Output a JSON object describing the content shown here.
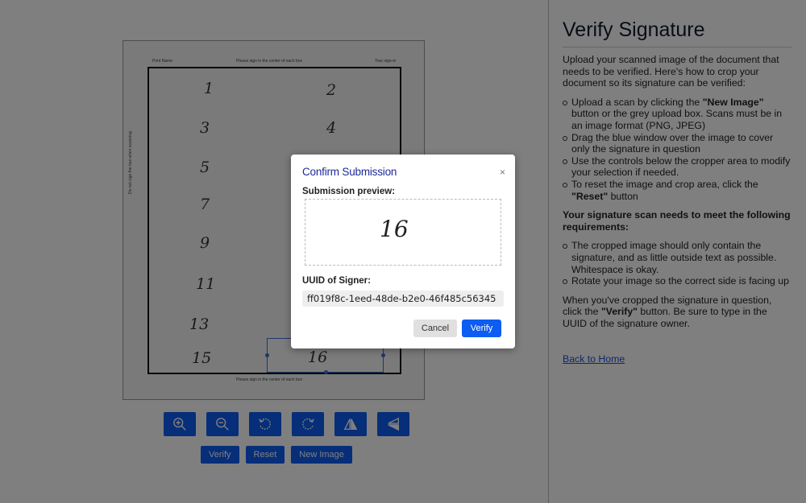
{
  "document": {
    "header_left": "Print Name",
    "header_center": "Please sign in the center of each box",
    "header_right": "Your sign-in",
    "side_text": "Do not sign the box when scanning",
    "footer_text": "Please sign in the center of each box",
    "numbers": [
      "1",
      "2",
      "3",
      "4",
      "5",
      "7",
      "9",
      "11",
      "13",
      "15"
    ],
    "crop_number": "16"
  },
  "toolbar": {
    "icons": [
      "zoom-in-icon",
      "zoom-out-icon",
      "rotate-left-icon",
      "rotate-right-icon",
      "flip-horizontal-icon",
      "flip-vertical-icon"
    ]
  },
  "actions": {
    "verify_label": "Verify",
    "reset_label": "Reset",
    "new_image_label": "New Image"
  },
  "panel": {
    "title": "Verify Signature",
    "intro": "Upload your scanned image of the document that needs to be verified. Here's how to crop your document so its signature can be verified:",
    "steps": [
      {
        "pre": "Upload a scan by clicking the ",
        "bold": "\"New Image\"",
        "post": " button or the grey upload box. Scans must be in an image format (PNG, JPEG)"
      },
      {
        "pre": "Drag the blue window over the image to cover only the signature in question",
        "bold": "",
        "post": ""
      },
      {
        "pre": "Use the controls below the cropper area to modify your selection if needed.",
        "bold": "",
        "post": ""
      },
      {
        "pre": "To reset the image and crop area, click the ",
        "bold": "\"Reset\"",
        "post": " button"
      }
    ],
    "requirements_heading": "Your signature scan needs to meet the following requirements:",
    "requirements": [
      "The cropped image should only contain the signature, and as little outside text as possible. Whitespace is okay.",
      "Rotate your image so the correct side is facing up"
    ],
    "closing_pre": "When you've cropped the signature in question, click the ",
    "closing_bold": "\"Verify\"",
    "closing_post": " button. Be sure to type in the UUID of the signature owner.",
    "back_link": "Back to Home"
  },
  "modal": {
    "title": "Confirm Submission",
    "close_glyph": "×",
    "preview_label": "Submission preview:",
    "preview_signature": "16",
    "uuid_label": "UUID of Signer:",
    "uuid_value": "ff019f8c-1eed-48de-b2e0-46f485c56345",
    "cancel_label": "Cancel",
    "verify_label": "Verify"
  },
  "colors": {
    "accent": "#0d5df2",
    "modal_title": "#1b2a9b",
    "link": "#1a4fd6",
    "overlay": "rgba(0,0,0,0.5)"
  }
}
